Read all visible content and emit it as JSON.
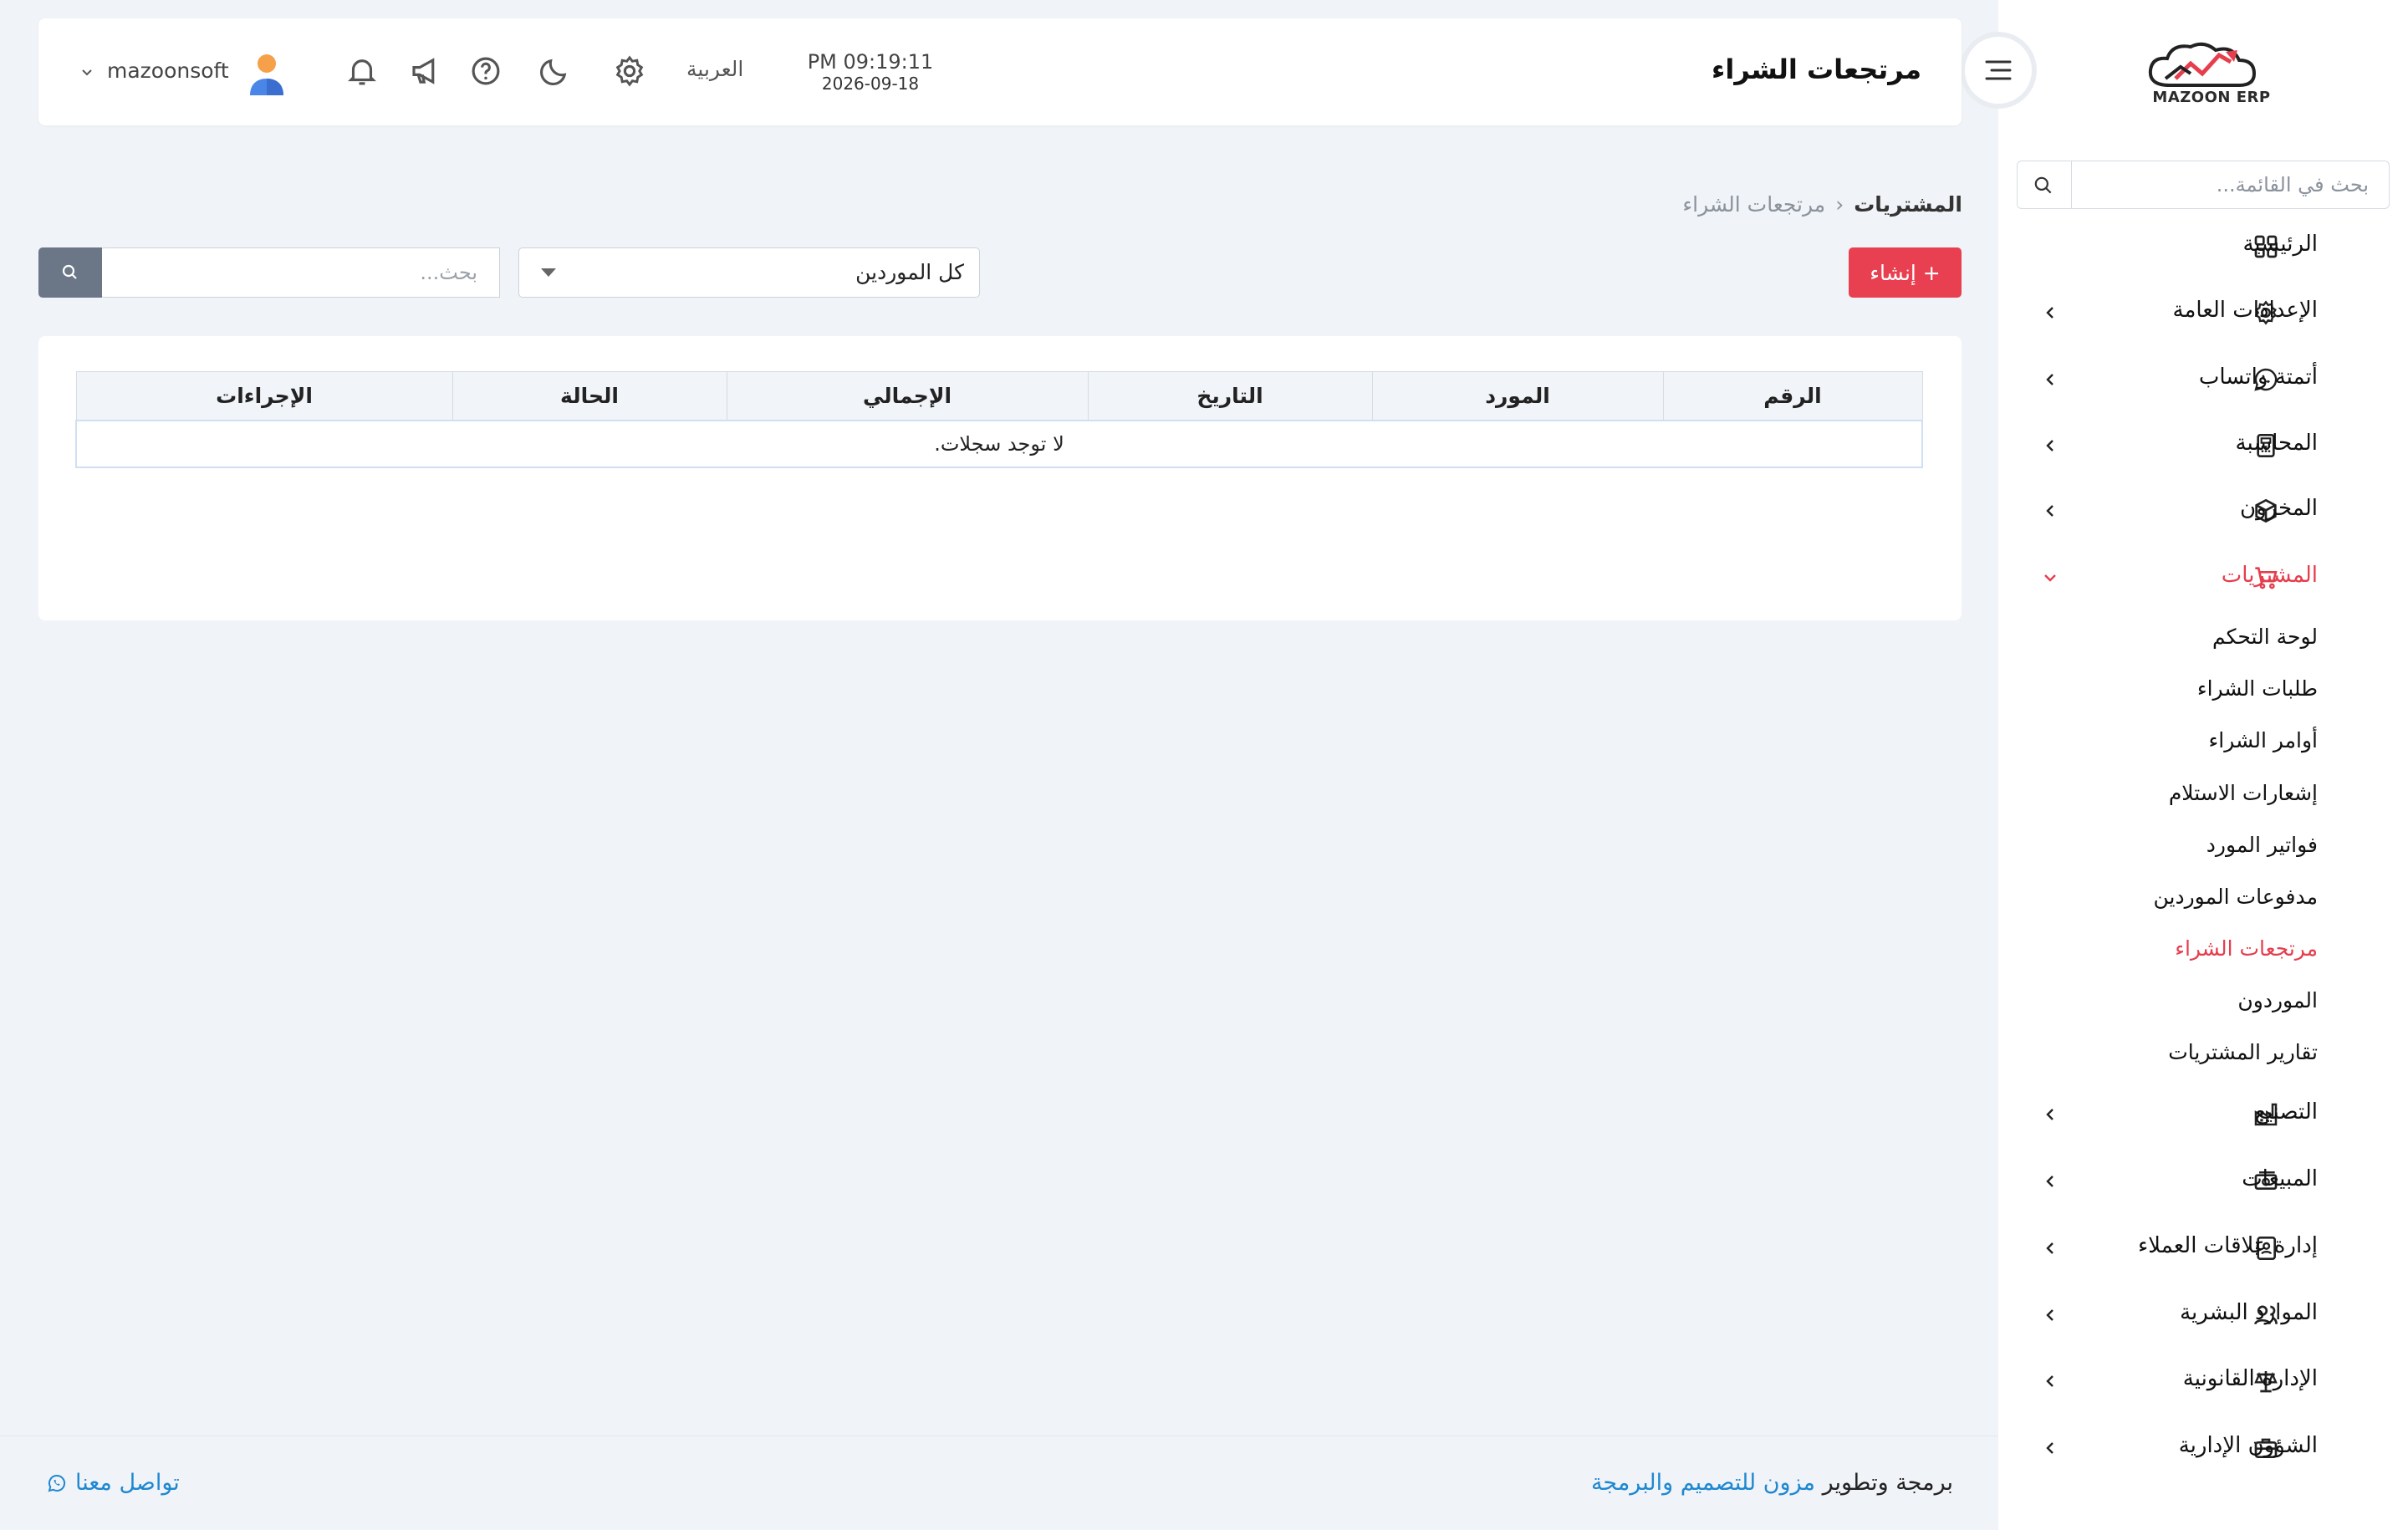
{
  "brand": {
    "name": "MAZOON ERP",
    "tagline": "ERP"
  },
  "sidebar": {
    "search_placeholder": "بحث في القائمة...",
    "items": [
      {
        "label": "الرئيسية",
        "icon": "grid-icon",
        "has_chevron": false
      },
      {
        "label": "الإعدادات العامة",
        "icon": "gear-icon",
        "has_chevron": true
      },
      {
        "label": "أتمتة واتساب",
        "icon": "whatsapp-icon",
        "has_chevron": true
      },
      {
        "label": "المحاسبة",
        "icon": "calculator-icon",
        "has_chevron": true
      },
      {
        "label": "المخزون",
        "icon": "box-icon",
        "has_chevron": true
      },
      {
        "label": "المشتريات",
        "icon": "cart-icon",
        "has_chevron": true,
        "expanded": true
      },
      {
        "label": "التصنيع",
        "icon": "factory-icon",
        "has_chevron": true
      },
      {
        "label": "المبيعات",
        "icon": "cash-icon",
        "has_chevron": true
      },
      {
        "label": "إدارة علاقات العملاء",
        "icon": "contacts-icon",
        "has_chevron": true
      },
      {
        "label": "الموارد البشرية",
        "icon": "users-icon",
        "has_chevron": true
      },
      {
        "label": "الإدارة القانونية",
        "icon": "scale-icon",
        "has_chevron": true
      },
      {
        "label": "الشؤون الإدارية",
        "icon": "briefcase-icon",
        "has_chevron": true
      }
    ],
    "purchases_sub": [
      {
        "label": "لوحة التحكم"
      },
      {
        "label": "طلبات الشراء"
      },
      {
        "label": "أوامر الشراء"
      },
      {
        "label": "إشعارات الاستلام"
      },
      {
        "label": "فواتير المورد"
      },
      {
        "label": "مدفوعات الموردين"
      },
      {
        "label": "مرتجعات الشراء",
        "active": true
      },
      {
        "label": "الموردون"
      },
      {
        "label": "تقارير المشتريات"
      }
    ]
  },
  "header": {
    "title": "مرتجعات الشراء",
    "time": "PM 09:19:11",
    "date": "2026-09-18",
    "language": "العربية",
    "username": "mazoonsoft"
  },
  "breadcrumb": {
    "parent": "المشتريات",
    "current": "مرتجعات الشراء"
  },
  "toolbar": {
    "create_label": "+ إنشاء",
    "supplier_filter": "كل الموردين",
    "search_placeholder": "بحث..."
  },
  "table": {
    "columns": [
      "الرقم",
      "المورد",
      "التاريخ",
      "الإجمالي",
      "الحالة",
      "الإجراءات"
    ],
    "empty_message": "لا توجد سجلات."
  },
  "footer": {
    "credit_prefix": "برمجة وتطوير",
    "credit_link": "مزون للتصميم والبرمجة",
    "contact": "تواصل معنا"
  },
  "colors": {
    "accent": "#e84050",
    "link": "#1e88d1",
    "search_button": "#6b7787"
  }
}
